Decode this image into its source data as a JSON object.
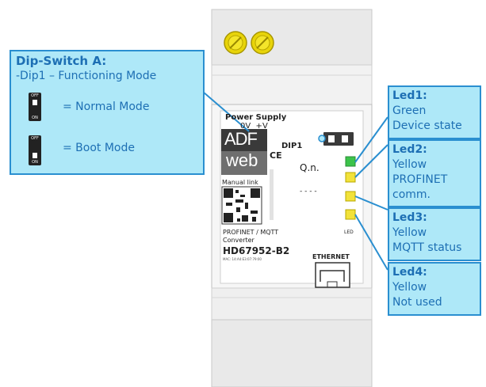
{
  "dip_switch": {
    "title": "Dip-Switch A:",
    "subtitle": "-Dip1 – Functioning Mode",
    "normal_label": "= Normal Mode",
    "boot_label": "= Boot Mode",
    "switch_off_text": "OFF",
    "switch_on_text": "ON"
  },
  "leds": [
    {
      "title": "Led1:",
      "line1": "Green",
      "line2": "Device state",
      "line3": ""
    },
    {
      "title": "Led2:",
      "line1": "Yellow",
      "line2": "PROFINET",
      "line3": "comm."
    },
    {
      "title": "Led3:",
      "line1": "Yellow",
      "line2": "MQTT status",
      "line3": ""
    },
    {
      "title": "Led4:",
      "line1": "Yellow",
      "line2": "Not used",
      "line3": ""
    }
  ],
  "device": {
    "power_supply": "Power Supply",
    "power_terminals": "0V  +V",
    "dip_label": "DIP1",
    "logo_top": "ADF",
    "logo_bottom": "web",
    "ce_mark": "CE",
    "manual_link": "Manual link",
    "qn_label": "Q.n.",
    "dots": "- - - -",
    "product_line1": "PROFINET / MQTT",
    "product_line2": "Converter",
    "model": "HD67952-B2",
    "mac": "MAC: 14:A4:E3:07:79:00",
    "ethernet": "ETHERNET",
    "led_label": "LED"
  },
  "colors": {
    "callout_bg": "#aee8f8",
    "callout_border": "#2a8fd0",
    "callout_text": "#1d6fb4",
    "led_green": "#3cc34a",
    "led_yellow": "#f2e23a"
  }
}
